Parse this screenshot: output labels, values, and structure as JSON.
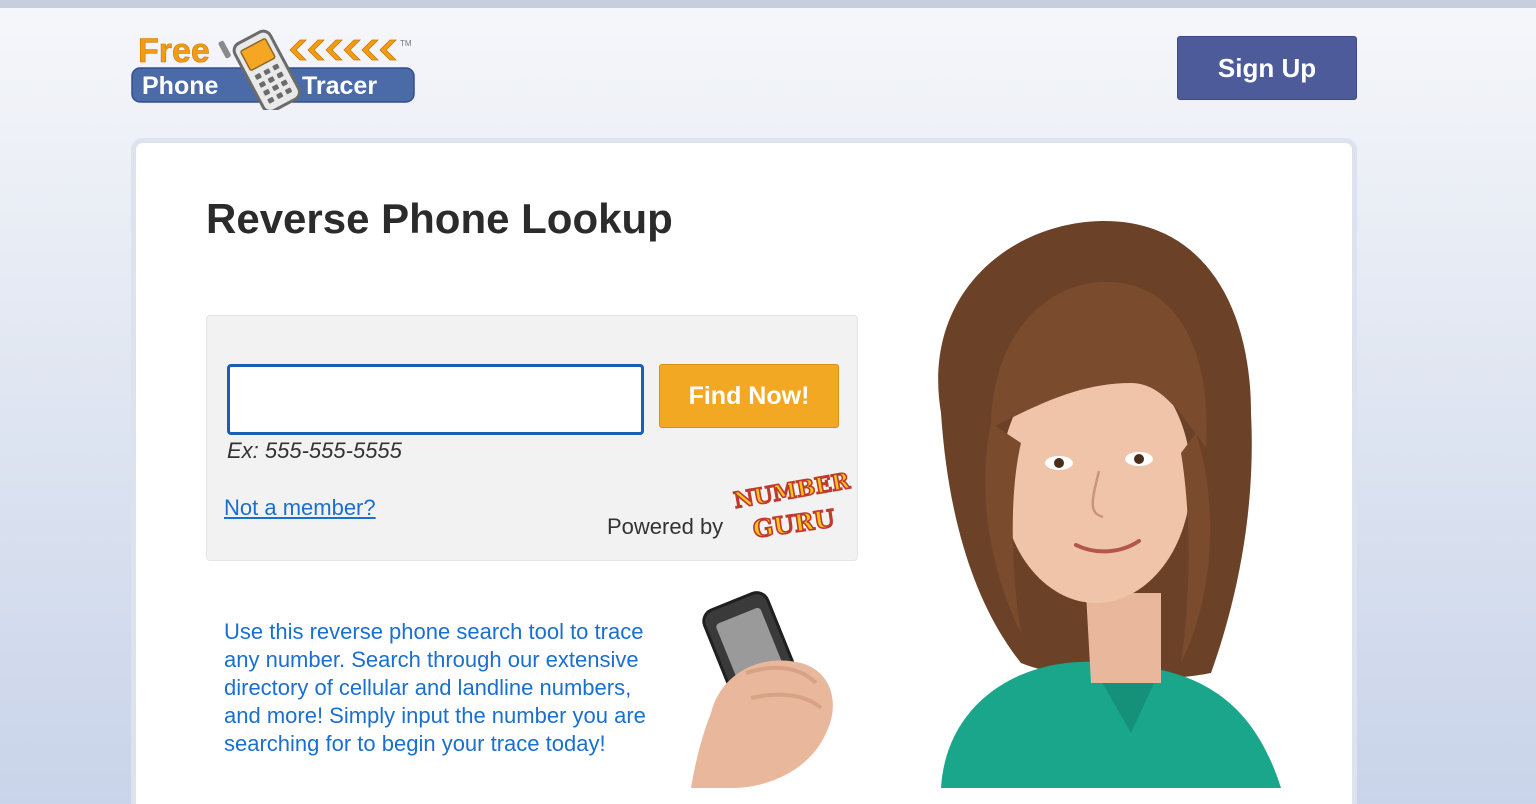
{
  "header": {
    "logo": {
      "word_free": "Free",
      "word_phone": "Phone",
      "word_tracer": "Tracer",
      "trademark": "TM"
    },
    "signup_label": "Sign Up"
  },
  "main": {
    "title": "Reverse Phone Lookup",
    "search": {
      "input_value": "",
      "placeholder": "",
      "button_label": "Find Now!",
      "example": "Ex: 555-555-5555",
      "member_link": "Not a member?",
      "powered_by": "Powered by",
      "partner_logo": {
        "line1": "NUMBER",
        "line2": "GURU"
      }
    },
    "description": "Use this reverse phone search tool to trace any number. Search through our extensive directory of cellular and landline numbers, and more! Simply input the number you are searching for to begin your trace today!"
  },
  "colors": {
    "signup_bg": "#4d5b9b",
    "find_button_bg": "#f3a823",
    "link": "#1a6fd0",
    "logo_orange": "#f39c12",
    "logo_blue": "#4a6aa8"
  }
}
